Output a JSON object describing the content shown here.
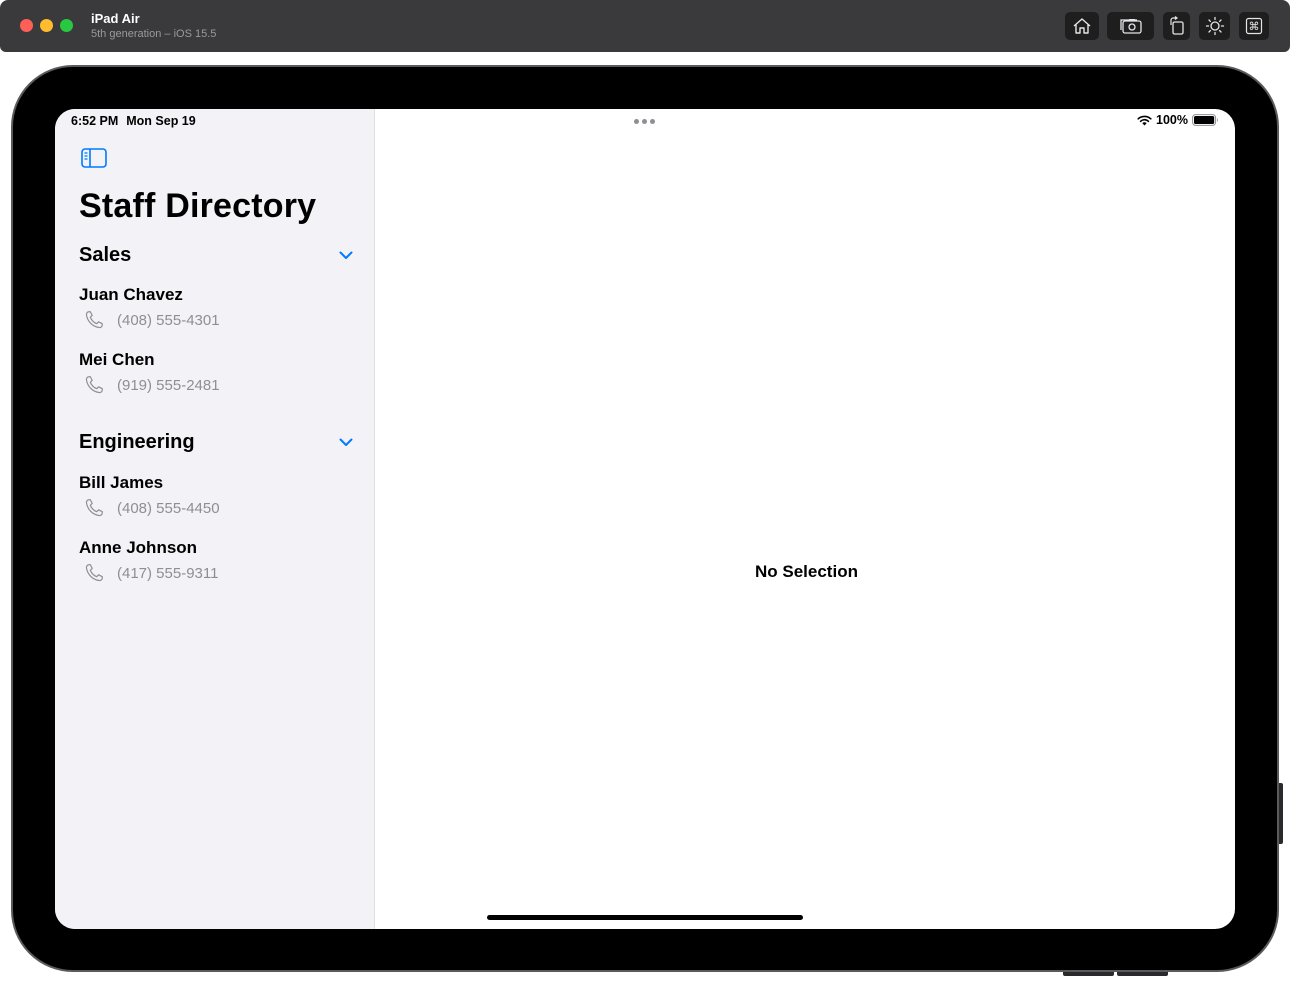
{
  "simulator": {
    "device_name": "iPad Air",
    "device_detail": "5th generation – iOS 15.5",
    "toolbar_icons": [
      "home-icon",
      "screenshot-icon",
      "rotate-icon",
      "appearance-icon",
      "command-icon"
    ]
  },
  "status_bar": {
    "time": "6:52 PM",
    "date": "Mon Sep 19",
    "battery": "100%"
  },
  "sidebar": {
    "title": "Staff Directory",
    "accent_color": "#007aff",
    "sections": [
      {
        "title": "Sales",
        "contacts": [
          {
            "name": "Juan Chavez",
            "phone": "(408) 555-4301"
          },
          {
            "name": "Mei Chen",
            "phone": "(919) 555-2481"
          }
        ]
      },
      {
        "title": "Engineering",
        "contacts": [
          {
            "name": "Bill James",
            "phone": "(408) 555-4450"
          },
          {
            "name": "Anne Johnson",
            "phone": "(417) 555-9311"
          }
        ]
      }
    ]
  },
  "detail": {
    "empty_text": "No Selection"
  }
}
